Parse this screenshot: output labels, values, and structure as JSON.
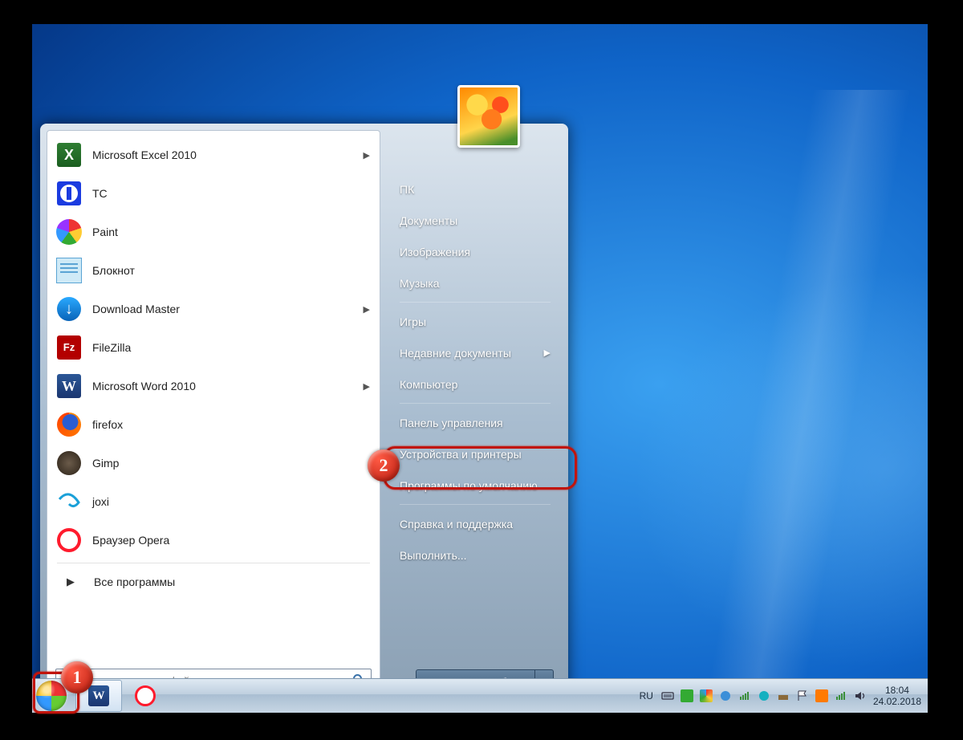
{
  "programs": [
    {
      "label": "Microsoft Excel 2010",
      "icon": "excel",
      "arrow": true
    },
    {
      "label": "TC",
      "icon": "tc",
      "arrow": false
    },
    {
      "label": "Paint",
      "icon": "paint",
      "arrow": false
    },
    {
      "label": "Блокнот",
      "icon": "notepad",
      "arrow": false
    },
    {
      "label": "Download Master",
      "icon": "dm",
      "arrow": true
    },
    {
      "label": "FileZilla",
      "icon": "filezilla",
      "arrow": false
    },
    {
      "label": "Microsoft Word 2010",
      "icon": "word",
      "arrow": true
    },
    {
      "label": "firefox",
      "icon": "firefox",
      "arrow": false
    },
    {
      "label": "Gimp",
      "icon": "gimp",
      "arrow": false
    },
    {
      "label": "joxi",
      "icon": "joxi",
      "arrow": false
    },
    {
      "label": "Браузер Opera",
      "icon": "opera",
      "arrow": false
    }
  ],
  "all_programs": "Все программы",
  "search": {
    "placeholder": "Найти программы и файлы"
  },
  "right_items": [
    {
      "label": "ПК",
      "sub": false
    },
    {
      "label": "Документы",
      "sub": false
    },
    {
      "label": "Изображения",
      "sub": false
    },
    {
      "label": "Музыка",
      "sub": false
    },
    {
      "label": "Игры",
      "sub": false
    },
    {
      "label": "Недавние документы",
      "sub": true
    },
    {
      "label": "Компьютер",
      "sub": false
    },
    {
      "label": "Панель управления",
      "sub": false,
      "highlight": true
    },
    {
      "label": "Устройства и принтеры",
      "sub": false
    },
    {
      "label": "Программы по умолчанию",
      "sub": false
    },
    {
      "label": "Справка и поддержка",
      "sub": false
    },
    {
      "label": "Выполнить...",
      "sub": false
    }
  ],
  "shutdown": "Завершение работы",
  "tray": {
    "lang": "RU",
    "time": "18:04",
    "date": "24.02.2018"
  },
  "markers": {
    "one": "1",
    "two": "2"
  }
}
